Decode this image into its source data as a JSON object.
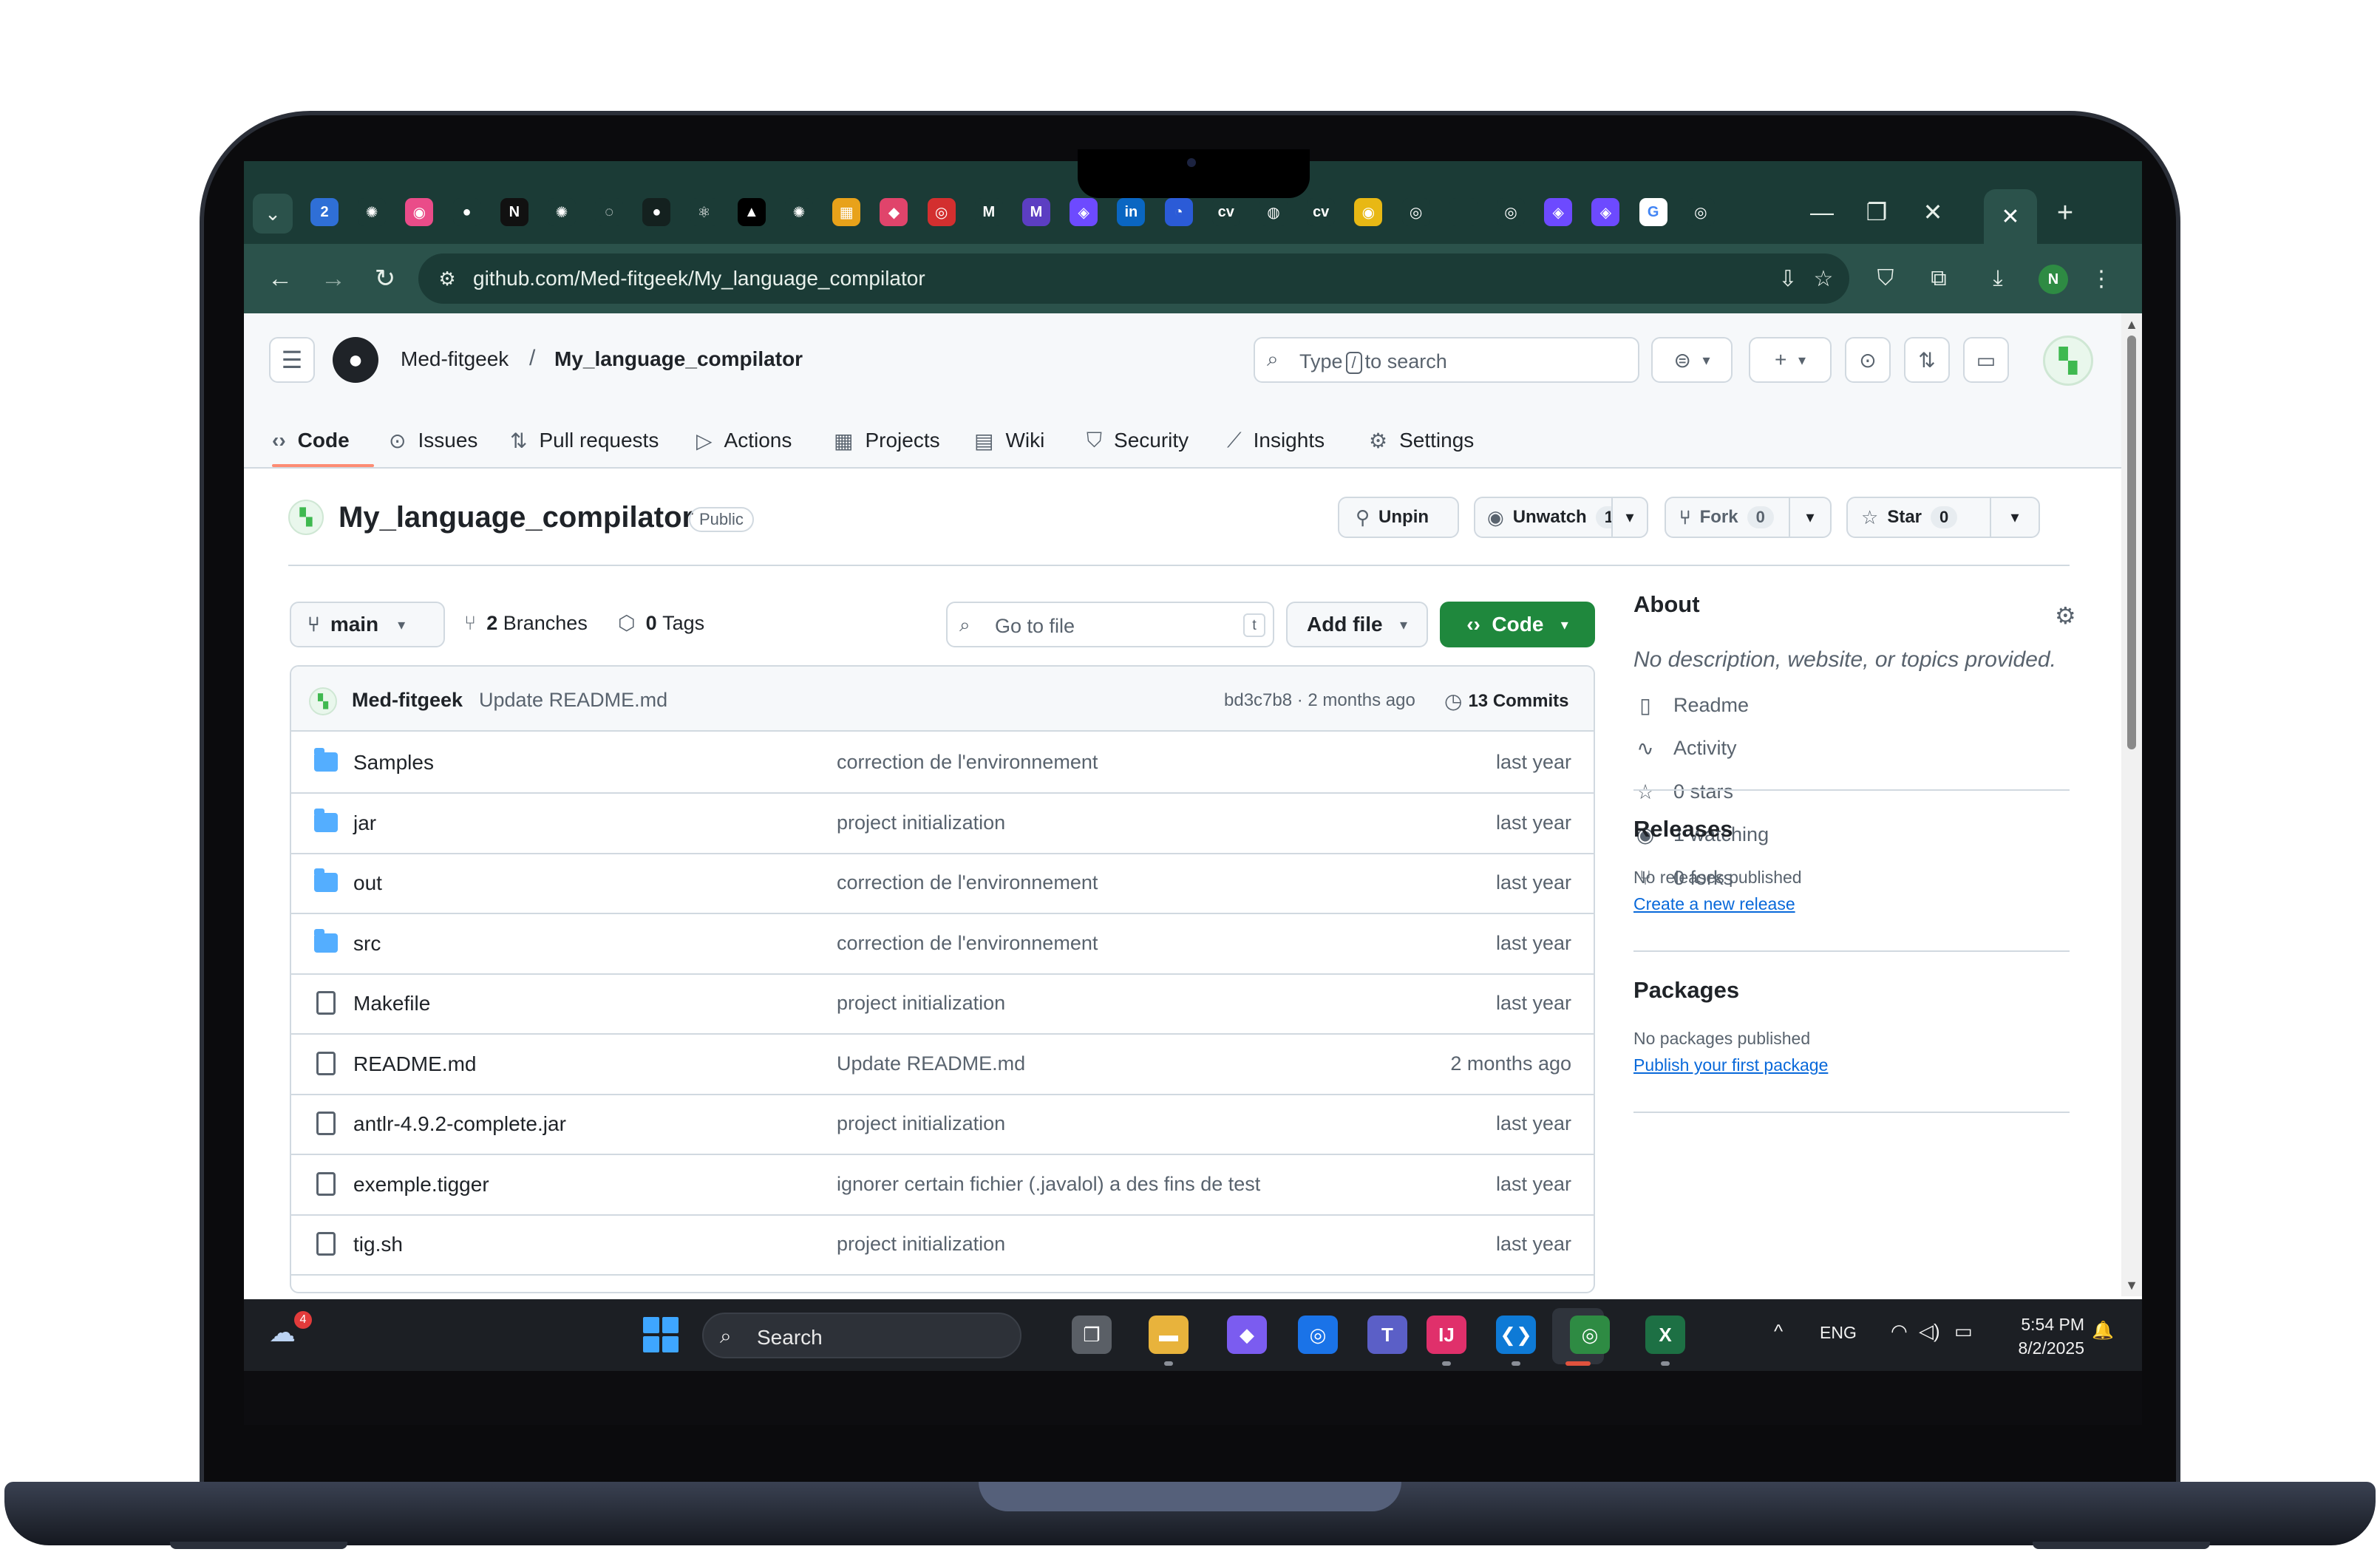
{
  "browser": {
    "tabs_search_icon": "chevron-down-icon",
    "tab_icons": [
      {
        "name": "calendar-tab-icon",
        "glyph": "2",
        "color": "#2f6fd6"
      },
      {
        "name": "chatgpt-tab-icon",
        "glyph": "✺",
        "color": "#1b3b36"
      },
      {
        "name": "dribbble-tab-icon",
        "glyph": "◉",
        "color": "#ea4c89"
      },
      {
        "name": "github-tab-icon",
        "glyph": "●",
        "color": "#1b3b36"
      },
      {
        "name": "notion-tab-icon",
        "glyph": "N",
        "color": "#111111"
      },
      {
        "name": "chatgpt-tab-icon-2",
        "glyph": "✺",
        "color": "#1b3b36"
      },
      {
        "name": "loading-tab-icon",
        "glyph": "◌",
        "color": "#1b3b36"
      },
      {
        "name": "github-dark-tab-icon",
        "glyph": "●",
        "color": "#14211f"
      },
      {
        "name": "react-tab-icon",
        "glyph": "⚛",
        "color": "#1b3b36"
      },
      {
        "name": "vercel-tab-icon",
        "glyph": "▲",
        "color": "#000000"
      },
      {
        "name": "openai-tab-icon",
        "glyph": "✺",
        "color": "#1b3b36"
      },
      {
        "name": "colorful-tab-icon",
        "glyph": "▦",
        "color": "#e8a21a"
      },
      {
        "name": "pink-app-tab-icon",
        "glyph": "◆",
        "color": "#e0446b"
      },
      {
        "name": "red-circle-tab-icon",
        "glyph": "◎",
        "color": "#d32f2f"
      },
      {
        "name": "gmail-tab-icon",
        "glyph": "M",
        "color": "#1b3b36"
      },
      {
        "name": "gmail-tab-icon-2",
        "glyph": "M",
        "color": "#5c3ec2"
      },
      {
        "name": "proton-tab-icon",
        "glyph": "◈",
        "color": "#6d4aff"
      },
      {
        "name": "linkedin-tab-icon",
        "glyph": "in",
        "color": "#0a66c2"
      },
      {
        "name": "progress-tab-icon",
        "glyph": "◔",
        "color": "#2b5bd7"
      },
      {
        "name": "cv-tab-icon",
        "glyph": "cv",
        "color": "#1b3b36"
      },
      {
        "name": "globe-tab-icon",
        "glyph": "◍",
        "color": "#1b3b36"
      },
      {
        "name": "cv-tab-icon-2",
        "glyph": "cv",
        "color": "#1b3b36"
      },
      {
        "name": "yellow-app-tab-icon",
        "glyph": "◉",
        "color": "#e8b814"
      },
      {
        "name": "chrome-tab-icon",
        "glyph": "◎",
        "color": "#1b3b36"
      },
      {
        "name": "blank-tab-icon",
        "glyph": "",
        "color": "#1b3b36"
      },
      {
        "name": "chrome-tab-icon-2",
        "glyph": "◎",
        "color": "#1b3b36"
      },
      {
        "name": "proton-tab-icon-2",
        "glyph": "◈",
        "color": "#6d4aff"
      },
      {
        "name": "proton-tab-icon-3",
        "glyph": "◈",
        "color": "#6d4aff"
      },
      {
        "name": "google-tab-icon",
        "glyph": "G",
        "color": "#ffffff"
      },
      {
        "name": "chrome-tab-icon-3",
        "glyph": "◎",
        "color": "#1b3b36"
      }
    ],
    "active_tab_close": "✕",
    "new_tab": "+",
    "window_controls": {
      "minimize": "—",
      "restore": "❐",
      "close": "✕"
    },
    "url": "github.com/Med-fitgeek/My_language_compilator",
    "profile_initial": "N"
  },
  "github": {
    "owner": "Med-fitgeek",
    "separator": "/",
    "repo": "My_language_compilator",
    "search": {
      "prefix": "Type",
      "key": "/",
      "suffix": "to search"
    },
    "nav": [
      {
        "label": "Code",
        "icon": "‹›",
        "name": "tab-code"
      },
      {
        "label": "Issues",
        "icon": "⊙",
        "name": "tab-issues"
      },
      {
        "label": "Pull requests",
        "icon": "⇅",
        "name": "tab-pull-requests"
      },
      {
        "label": "Actions",
        "icon": "▷",
        "name": "tab-actions"
      },
      {
        "label": "Projects",
        "icon": "▦",
        "name": "tab-projects"
      },
      {
        "label": "Wiki",
        "icon": "▤",
        "name": "tab-wiki"
      },
      {
        "label": "Security",
        "icon": "⛉",
        "name": "tab-security"
      },
      {
        "label": "Insights",
        "icon": "⟋",
        "name": "tab-insights"
      },
      {
        "label": "Settings",
        "icon": "⚙",
        "name": "tab-settings"
      }
    ],
    "visibility": "Public",
    "actions": {
      "unpin": "Unpin",
      "unwatch": "Unwatch",
      "watch_count": "1",
      "fork": "Fork",
      "fork_count": "0",
      "star": "Star",
      "star_count": "0"
    },
    "branch": "main",
    "branches_count": "2",
    "branches_label": "Branches",
    "tags_count": "0",
    "tags_label": "Tags",
    "goto_placeholder": "Go to file",
    "goto_key": "t",
    "add_file": "Add file",
    "code_button": "Code",
    "last_commit": {
      "author": "Med-fitgeek",
      "message": "Update README.md",
      "hash_time": "bd3c7b8 · 2 months ago",
      "commits_count": "13",
      "commits_label": "Commits"
    },
    "files": [
      {
        "name": "Samples",
        "type": "folder",
        "message": "correction de l'environnement",
        "time": "last year"
      },
      {
        "name": "jar",
        "type": "folder",
        "message": "project initialization",
        "time": "last year"
      },
      {
        "name": "out",
        "type": "folder",
        "message": "correction de l'environnement",
        "time": "last year"
      },
      {
        "name": "src",
        "type": "folder",
        "message": "correction de l'environnement",
        "time": "last year"
      },
      {
        "name": "Makefile",
        "type": "file",
        "message": "project initialization",
        "time": "last year"
      },
      {
        "name": "README.md",
        "type": "file",
        "message": "Update README.md",
        "time": "2 months ago"
      },
      {
        "name": "antlr-4.9.2-complete.jar",
        "type": "file",
        "message": "project initialization",
        "time": "last year"
      },
      {
        "name": "exemple.tigger",
        "type": "file",
        "message": "ignorer certain fichier (.javalol) a des fins de test",
        "time": "last year"
      },
      {
        "name": "tig.sh",
        "type": "file",
        "message": "project initialization",
        "time": "last year"
      }
    ],
    "about": {
      "title": "About",
      "description": "No description, website, or topics provided.",
      "items": [
        {
          "icon": "▯",
          "label": "Readme",
          "name": "about-readme"
        },
        {
          "icon": "∿",
          "label": "Activity",
          "name": "about-activity"
        },
        {
          "icon": "☆",
          "label": "0 stars",
          "name": "about-stars"
        },
        {
          "icon": "◉",
          "label": "1 watching",
          "name": "about-watching"
        },
        {
          "icon": "⑂",
          "label": "0 forks",
          "name": "about-forks"
        }
      ]
    },
    "releases": {
      "title": "Releases",
      "empty": "No releases published",
      "link": "Create a new release"
    },
    "packages": {
      "title": "Packages",
      "empty": "No packages published",
      "link": "Publish your first package"
    }
  },
  "taskbar": {
    "weather_badge": "4",
    "search": "Search",
    "apps": [
      {
        "name": "task-view-icon",
        "glyph": "❐",
        "color": "#5a5f66"
      },
      {
        "name": "file-explorer-icon",
        "glyph": "▬",
        "color": "#e8b33c"
      },
      {
        "name": "m365-copilot-icon",
        "glyph": "◆",
        "color": "#7b5cf0"
      },
      {
        "name": "chrome-icon",
        "glyph": "◎",
        "color": "#1a73e8"
      },
      {
        "name": "teams-icon",
        "glyph": "T",
        "color": "#5b5fc7"
      },
      {
        "name": "intellij-icon",
        "glyph": "IJ",
        "color": "#e0306b"
      },
      {
        "name": "vscode-icon",
        "glyph": "❮❯",
        "color": "#0e7ad6"
      },
      {
        "name": "chrome-profile-icon",
        "glyph": "◎",
        "color": "#2e8b43"
      },
      {
        "name": "excel-icon",
        "glyph": "X",
        "color": "#1d7044"
      }
    ],
    "tray": {
      "chevron": "^",
      "language": "ENG",
      "wifi": "◠",
      "volume": "◁)",
      "battery": "▭",
      "notification": "🔔"
    },
    "time": "5:54 PM",
    "date": "8/2/2025"
  }
}
